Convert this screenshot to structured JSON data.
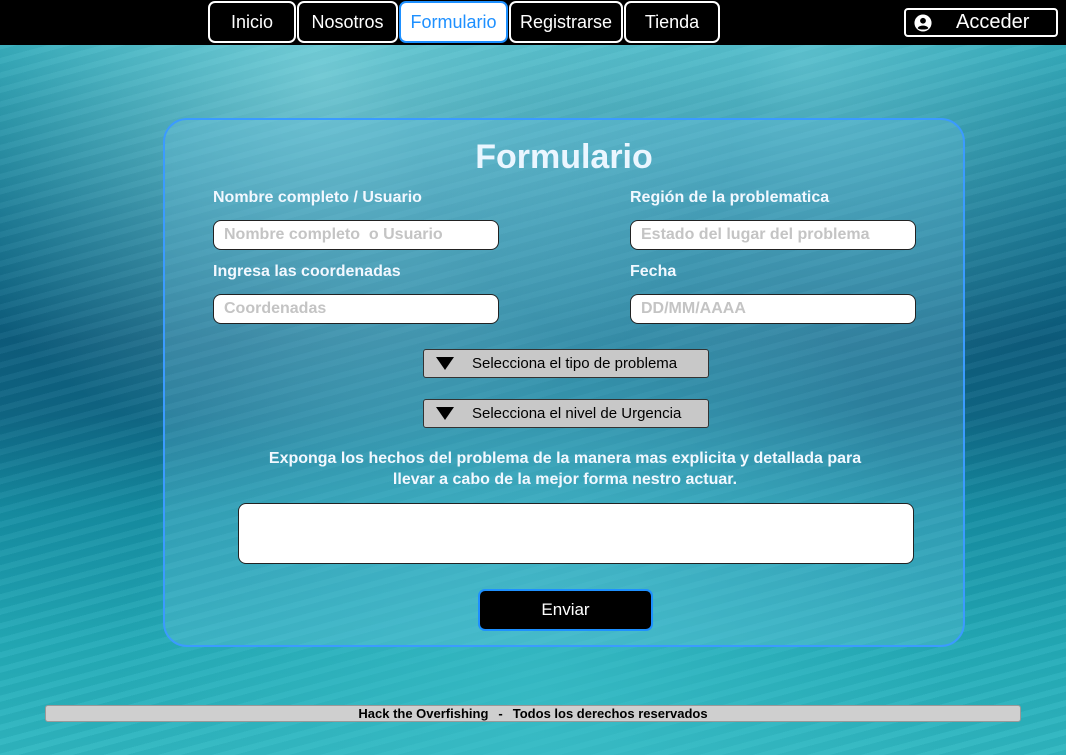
{
  "nav": {
    "items": [
      {
        "label": "Inicio"
      },
      {
        "label": "Nosotros"
      },
      {
        "label": "Formulario"
      },
      {
        "label": "Registrarse"
      },
      {
        "label": "Tienda"
      }
    ],
    "active": "Formulario",
    "login_label": "Acceder"
  },
  "form": {
    "title": "Formulario",
    "name_label": "Nombre completo / Usuario",
    "name_placeholder": "Nombre completo  o Usuario",
    "region_label": "Región de la problematica",
    "region_placeholder": "Estado del lugar del problema",
    "coords_label": "Ingresa las coordenadas",
    "coords_placeholder": "Coordenadas",
    "date_label": "Fecha",
    "date_placeholder": "DD/MM/AAAA",
    "problem_type_label": "Selecciona el tipo de problema",
    "urgency_label": "Selecciona el nivel de Urgencia",
    "instructions_line1": "Exponga los hechos del problema de la manera mas explicita y detallada para",
    "instructions_line2": "llevar a cabo de la mejor forma nestro actuar.",
    "description_value": "",
    "submit_label": "Enviar"
  },
  "footer": {
    "left": "Hack the Overfishing",
    "separator": "-",
    "right": "Todos los derechos reservados"
  },
  "colors": {
    "accent": "#1e90ff",
    "nav_bg": "#000000",
    "select_bg": "#c8c8c8"
  },
  "icons": {
    "login": "user-circle-icon",
    "dropdown": "triangle-down-icon"
  }
}
